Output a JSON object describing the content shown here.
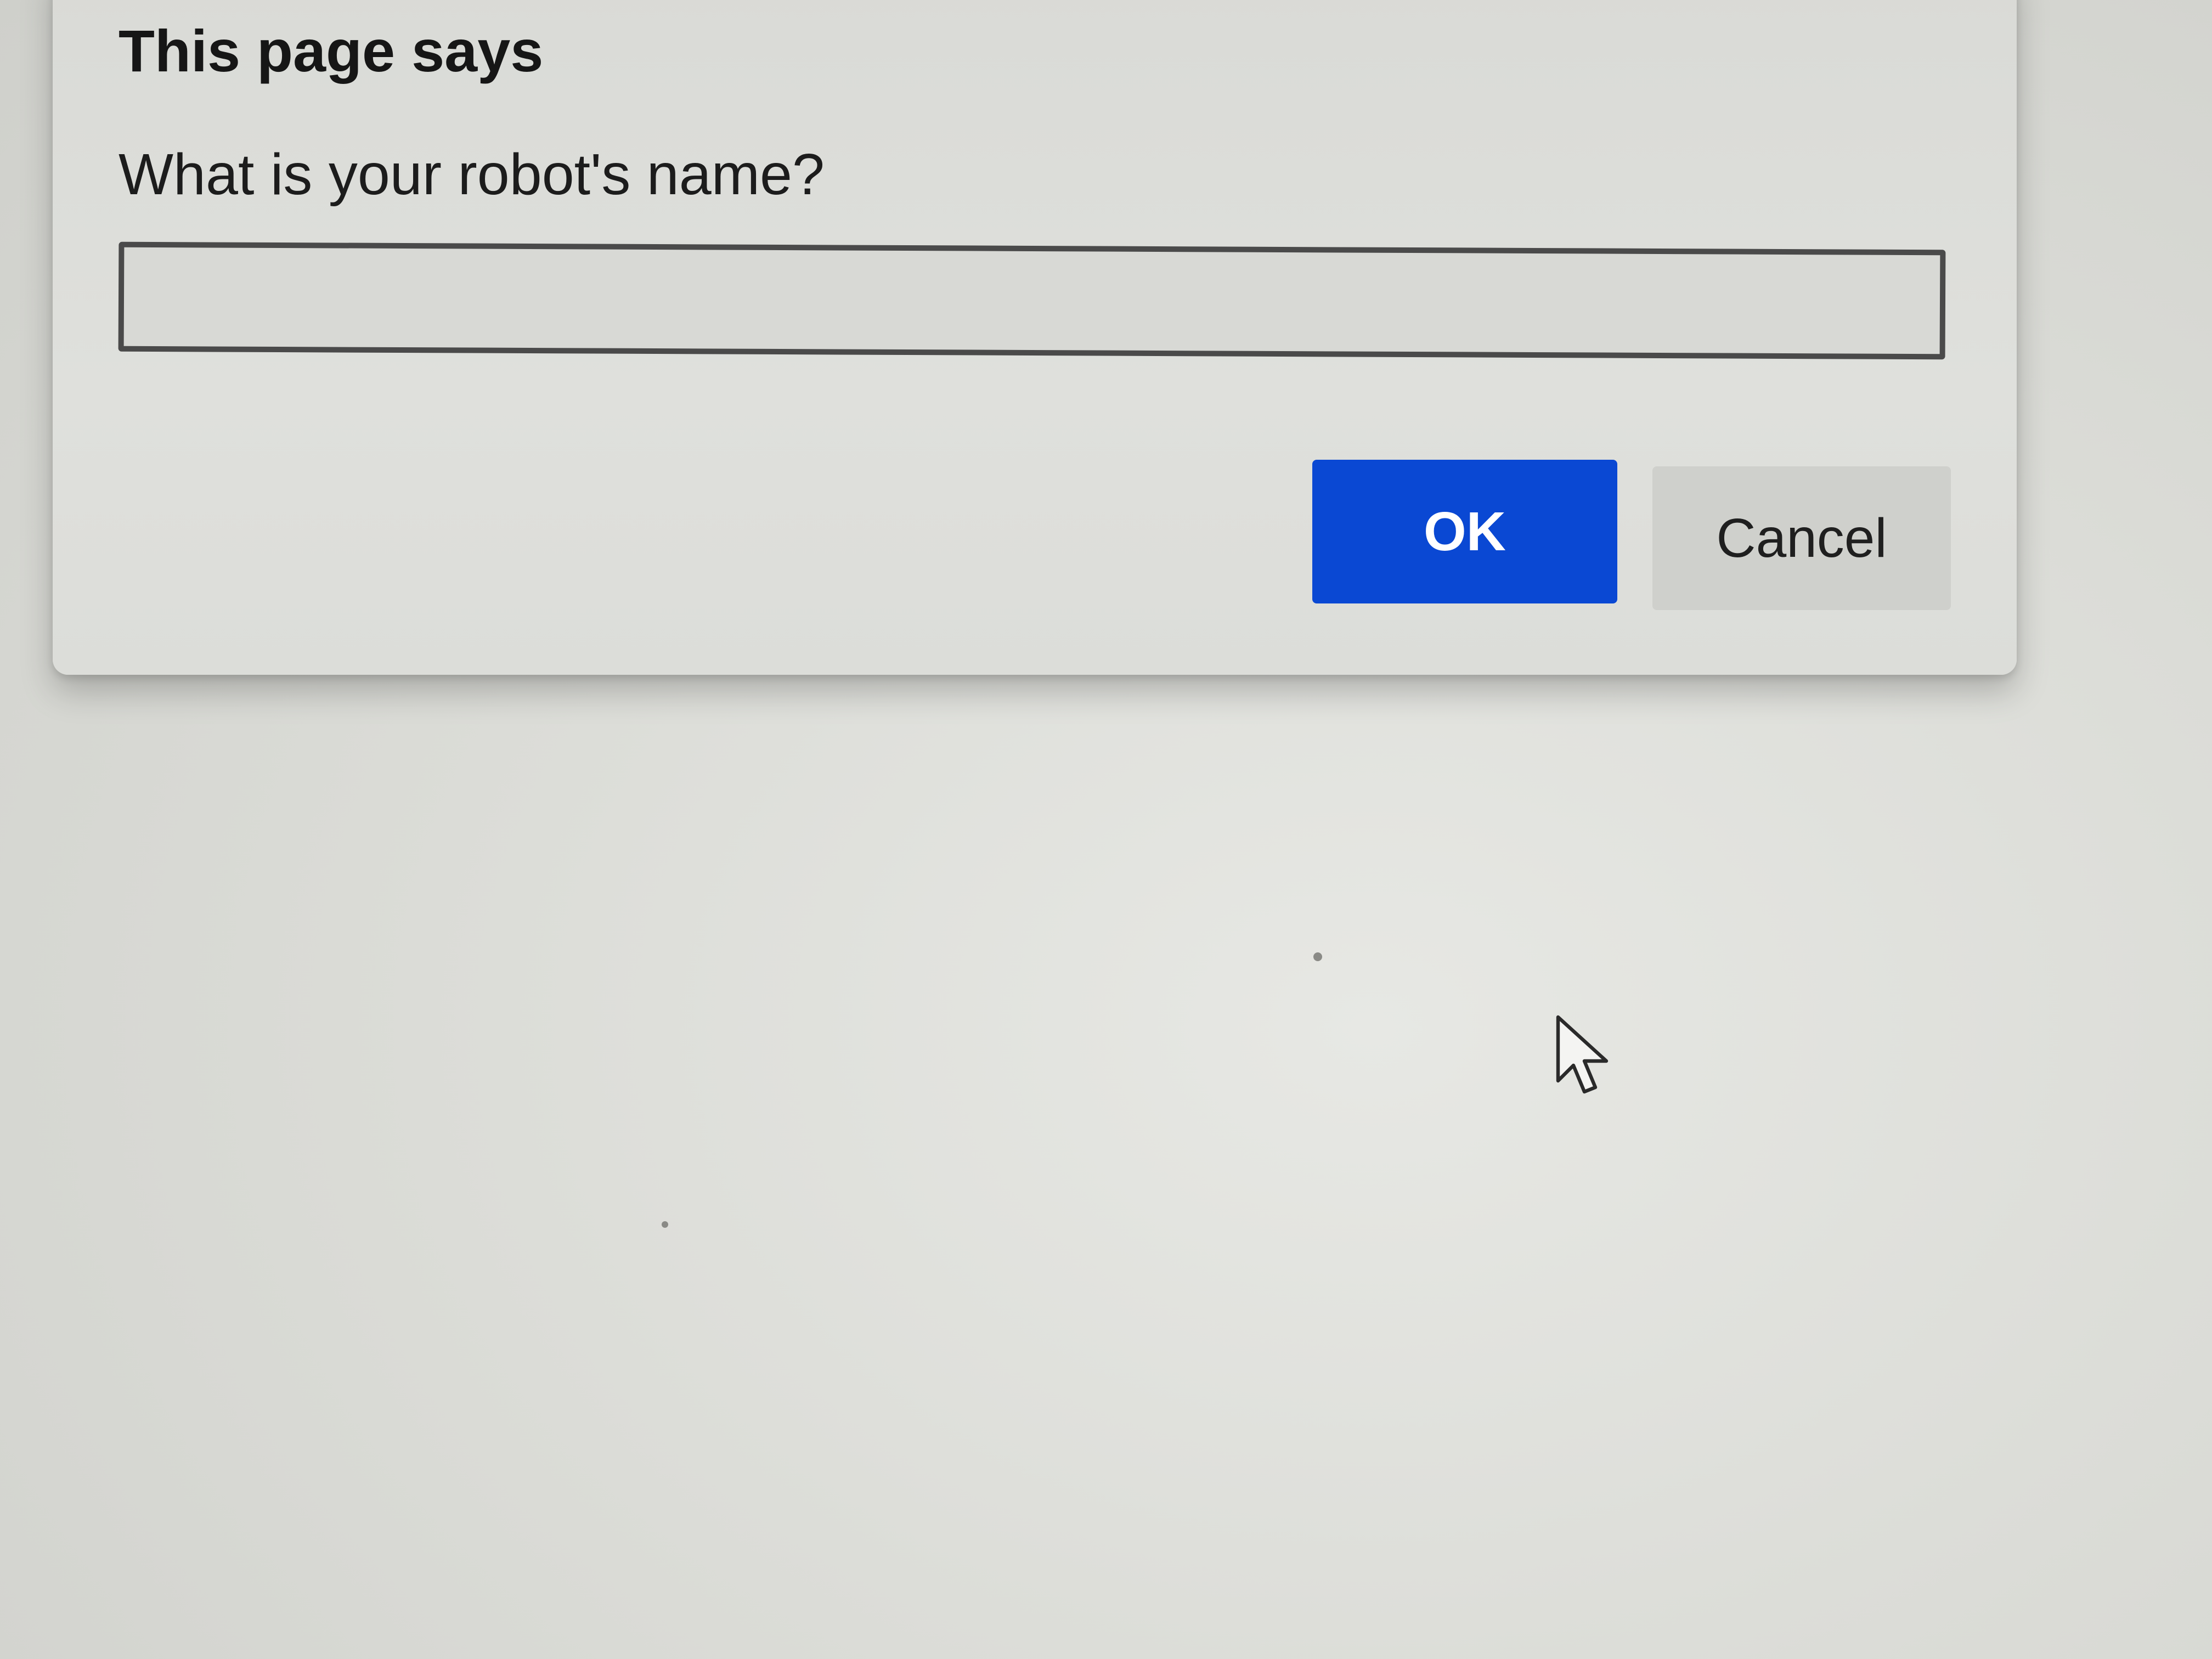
{
  "dialog": {
    "title": "This page says",
    "message": "What is your robot's name?",
    "input": {
      "value": "",
      "placeholder": ""
    },
    "ok_label": "OK",
    "cancel_label": "Cancel"
  },
  "colors": {
    "ok_button": "#0a48d3",
    "cancel_button": "#cfd0cc",
    "background": "#dcddd8"
  },
  "icons": {
    "cursor": "mouse-pointer-arrow-icon"
  }
}
